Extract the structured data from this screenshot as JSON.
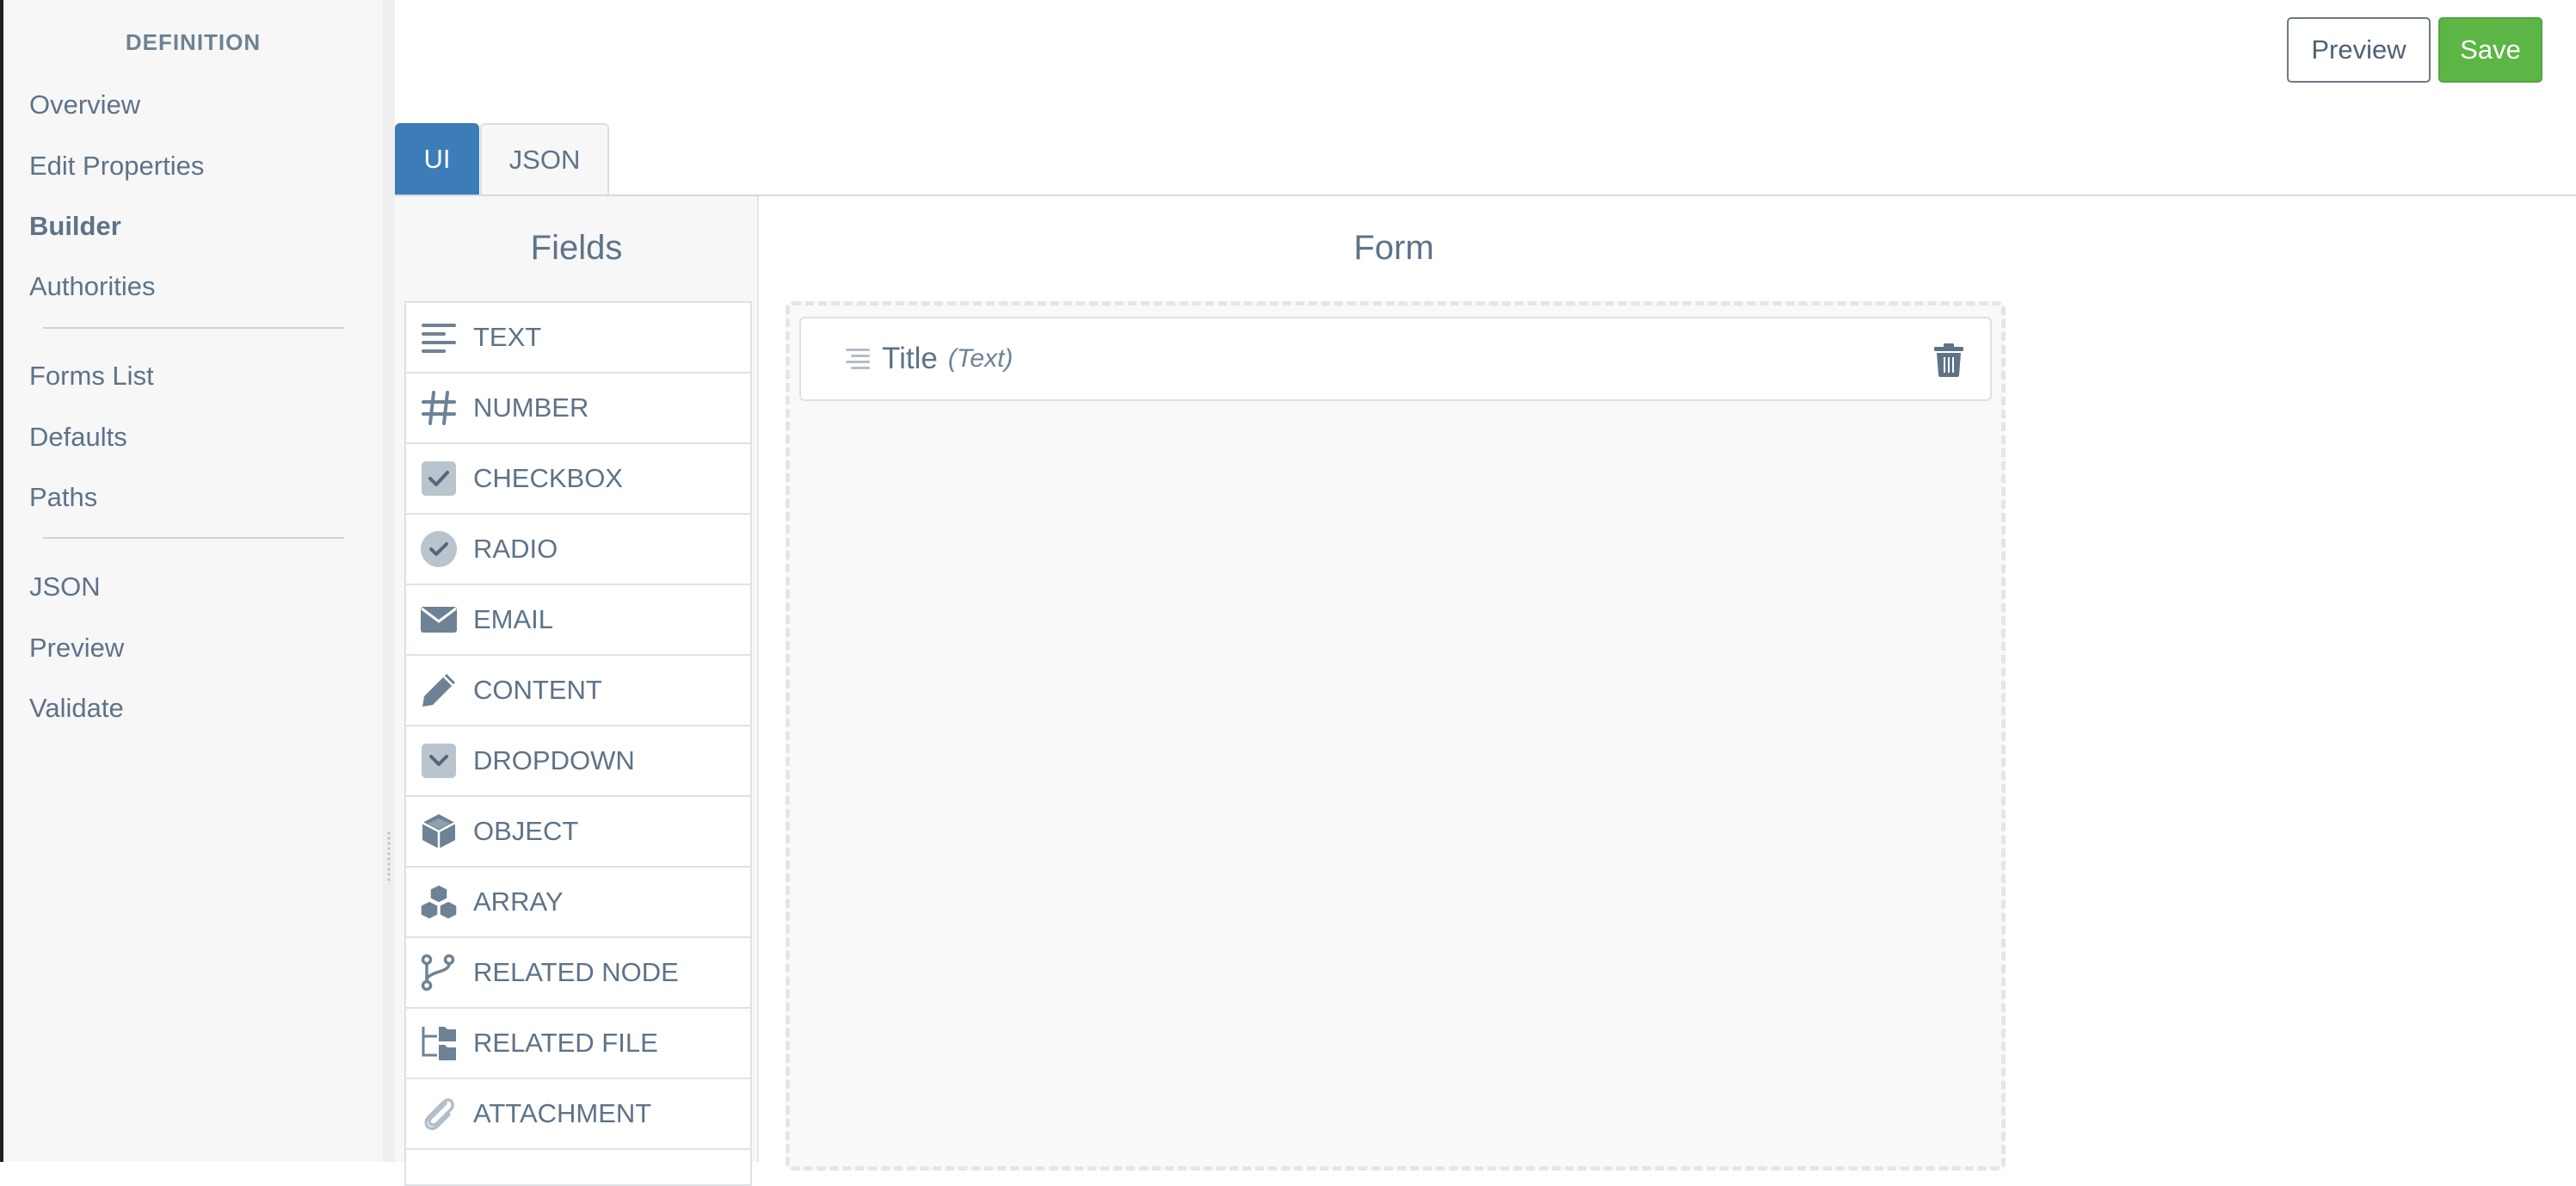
{
  "sidebar": {
    "heading": "DEFINITION",
    "group1": [
      {
        "label": "Overview",
        "active": false
      },
      {
        "label": "Edit Properties",
        "active": false
      },
      {
        "label": "Builder",
        "active": true
      },
      {
        "label": "Authorities",
        "active": false
      }
    ],
    "group2": [
      {
        "label": "Forms List"
      },
      {
        "label": "Defaults"
      },
      {
        "label": "Paths"
      }
    ],
    "group3": [
      {
        "label": "JSON"
      },
      {
        "label": "Preview"
      },
      {
        "label": "Validate"
      }
    ]
  },
  "toolbar": {
    "preview_label": "Preview",
    "save_label": "Save"
  },
  "tabs": [
    {
      "label": "UI",
      "active": true
    },
    {
      "label": "JSON",
      "active": false
    }
  ],
  "fields_panel": {
    "title": "Fields",
    "items": [
      {
        "label": "TEXT",
        "icon": "text-lines-icon"
      },
      {
        "label": "NUMBER",
        "icon": "hash-icon"
      },
      {
        "label": "CHECKBOX",
        "icon": "checkbox-icon"
      },
      {
        "label": "RADIO",
        "icon": "radio-check-icon"
      },
      {
        "label": "EMAIL",
        "icon": "envelope-icon"
      },
      {
        "label": "CONTENT",
        "icon": "pencil-icon"
      },
      {
        "label": "DROPDOWN",
        "icon": "dropdown-icon"
      },
      {
        "label": "OBJECT",
        "icon": "cube-icon"
      },
      {
        "label": "ARRAY",
        "icon": "cubes-icon"
      },
      {
        "label": "RELATED NODE",
        "icon": "branch-icon"
      },
      {
        "label": "RELATED FILE",
        "icon": "folder-tree-icon"
      },
      {
        "label": "ATTACHMENT",
        "icon": "paperclip-icon"
      }
    ]
  },
  "form": {
    "title": "Form",
    "fields": [
      {
        "title": "Title",
        "type": "(Text)"
      }
    ]
  },
  "colors": {
    "primary_tab": "#3c7db7",
    "save_button": "#5cb646",
    "text": "#5d7388"
  }
}
